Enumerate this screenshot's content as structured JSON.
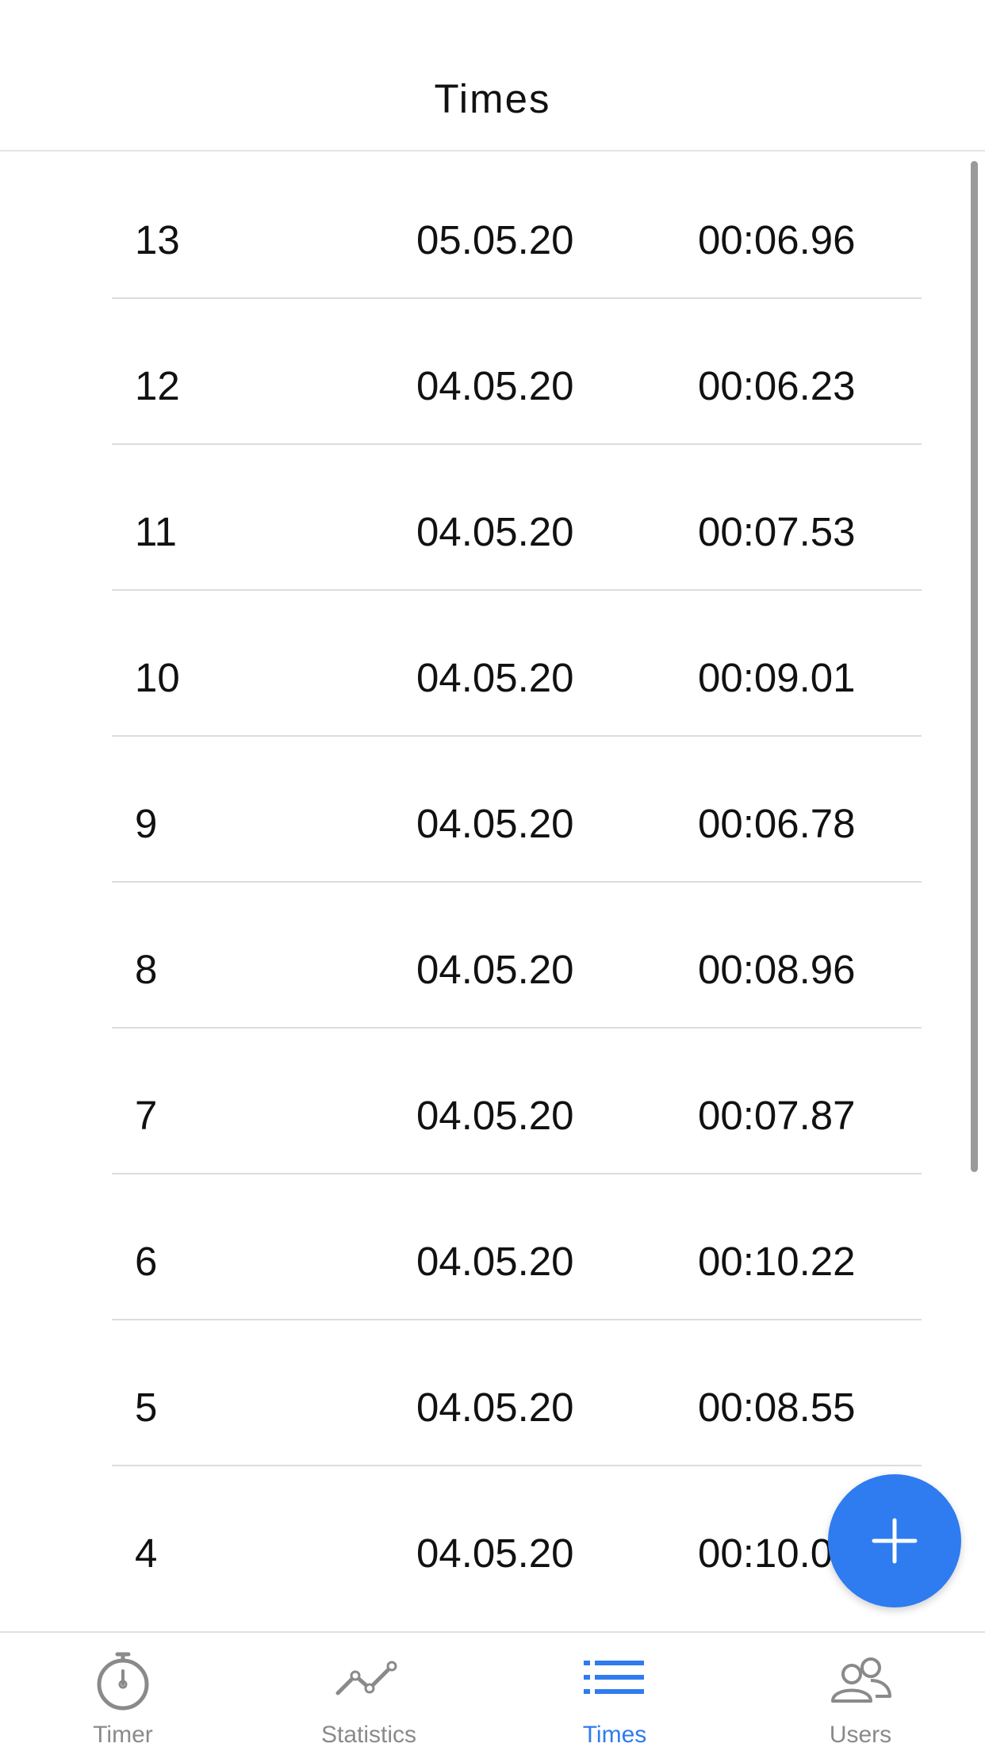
{
  "header": {
    "title": "Times"
  },
  "times": {
    "rows": [
      {
        "number": "13",
        "date": "05.05.20",
        "time": "00:06.96"
      },
      {
        "number": "12",
        "date": "04.05.20",
        "time": "00:06.23"
      },
      {
        "number": "11",
        "date": "04.05.20",
        "time": "00:07.53"
      },
      {
        "number": "10",
        "date": "04.05.20",
        "time": "00:09.01"
      },
      {
        "number": "9",
        "date": "04.05.20",
        "time": "00:06.78"
      },
      {
        "number": "8",
        "date": "04.05.20",
        "time": "00:08.96"
      },
      {
        "number": "7",
        "date": "04.05.20",
        "time": "00:07.87"
      },
      {
        "number": "6",
        "date": "04.05.20",
        "time": "00:10.22"
      },
      {
        "number": "5",
        "date": "04.05.20",
        "time": "00:08.55"
      },
      {
        "number": "4",
        "date": "04.05.20",
        "time": "00:10.0"
      }
    ]
  },
  "fab": {
    "icon": "plus-icon"
  },
  "tabbar": {
    "tabs": [
      {
        "label": "Timer",
        "icon": "stopwatch-icon",
        "active": false
      },
      {
        "label": "Statistics",
        "icon": "line-chart-icon",
        "active": false
      },
      {
        "label": "Times",
        "icon": "list-icon",
        "active": true
      },
      {
        "label": "Users",
        "icon": "users-icon",
        "active": false
      }
    ]
  },
  "colors": {
    "accent": "#2f7bf0",
    "inactive": "#8a8a8a",
    "divider": "#dcdcdc",
    "text": "#111111"
  }
}
